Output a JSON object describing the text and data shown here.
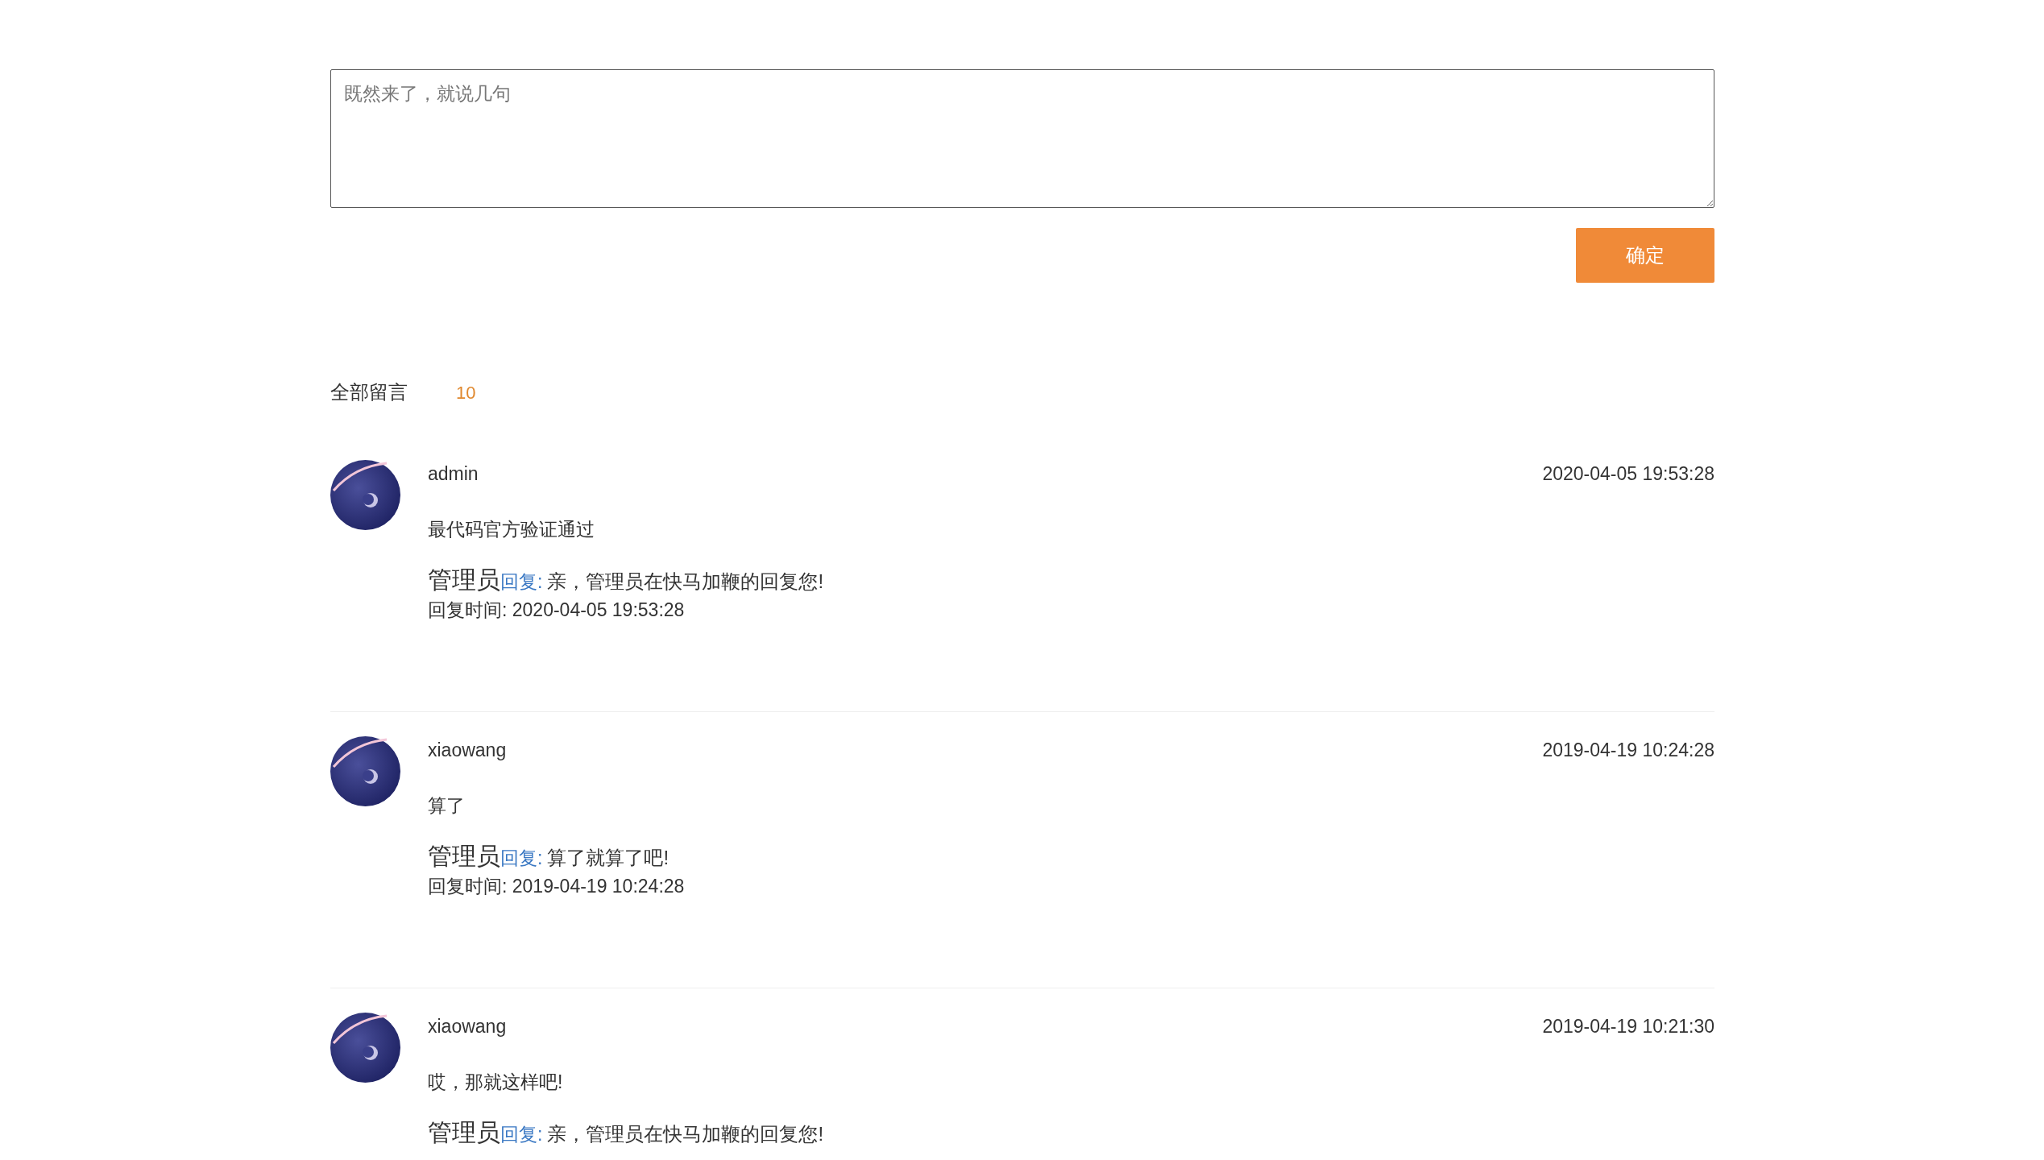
{
  "comment_form": {
    "placeholder": "既然来了，就说几句",
    "submit": "确定"
  },
  "comments_header": {
    "title": "全部留言",
    "count": "10"
  },
  "comments": [
    {
      "user": "admin",
      "date": "2020-04-05 19:53:28",
      "content": "最代码官方验证通过",
      "reply": {
        "author": "管理员",
        "label": "回复:",
        "text": "亲，管理员在快马加鞭的回复您!",
        "time": "回复时间: 2020-04-05 19:53:28"
      }
    },
    {
      "user": "xiaowang",
      "date": "2019-04-19 10:24:28",
      "content": "算了",
      "reply": {
        "author": "管理员",
        "label": "回复:",
        "text": "算了就算了吧!",
        "time": "回复时间: 2019-04-19 10:24:28"
      }
    },
    {
      "user": "xiaowang",
      "date": "2019-04-19 10:21:30",
      "content": "哎，那就这样吧!",
      "reply": {
        "author": "管理员",
        "label": "回复:",
        "text": "亲，管理员在快马加鞭的回复您!"
      }
    }
  ]
}
